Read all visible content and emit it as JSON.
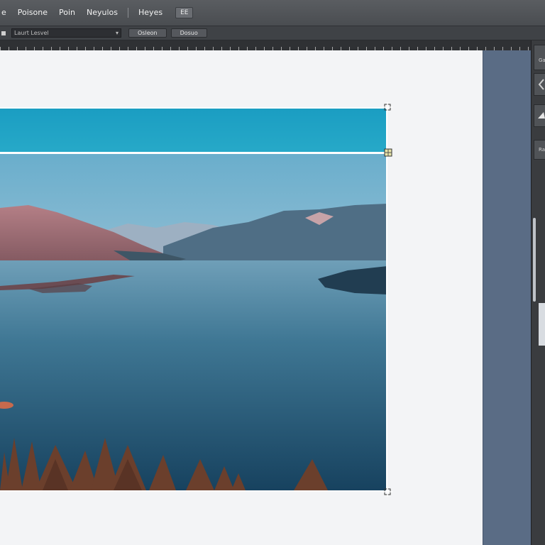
{
  "menubar": {
    "items": [
      "e",
      "Poisone",
      "Poin",
      "Neyulos",
      "Heyes"
    ],
    "separator": "|",
    "chip_label": "EE"
  },
  "options": {
    "field_value": "Laurt Lesvel",
    "field_arrow": "▾",
    "buttons": [
      "Osleon",
      "Dosuo"
    ]
  },
  "right_panel": {
    "labels": [
      "Ga",
      "Ra"
    ]
  },
  "colors": {
    "accent": "#5a6c85",
    "selection": "#ffffff"
  }
}
